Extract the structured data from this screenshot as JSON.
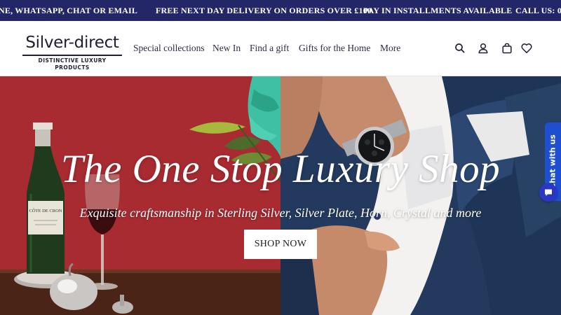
{
  "announcement": {
    "messages": [
      "NE, WHATSAPP, CHAT OR EMAIL",
      "FREE NEXT DAY DELIVERY ON ORDERS OVER £100",
      "PAY IN INSTALLMENTS AVAILABLE",
      "CALL US: 0"
    ]
  },
  "header": {
    "logo": {
      "name": "Silver-direct",
      "tagline": "DISTINCTIVE LUXURY PRODUCTS"
    },
    "nav": [
      {
        "label": "Special collections"
      },
      {
        "label": "New In"
      },
      {
        "label": "Find a gift"
      },
      {
        "label": "Gifts for the Home"
      },
      {
        "label": "More"
      }
    ],
    "icons": [
      "search-icon",
      "user-icon",
      "bag-icon",
      "heart-icon"
    ]
  },
  "hero": {
    "title": "The One Stop Luxury Shop",
    "subtitle": "Exquisite craftsmanship in Sterling Silver, Silver Plate, Horn, Crystal and more",
    "cta_label": "SHOP NOW",
    "bottle_label": "CÔTE DE CRON"
  },
  "chat": {
    "label": "Chat with us"
  },
  "colors": {
    "announcement_bg": "#232667",
    "nav_text": "#2b2b44",
    "chat_blue": "#1e4fd0",
    "hero_red": "#b53036",
    "hero_navy": "#23375a"
  }
}
